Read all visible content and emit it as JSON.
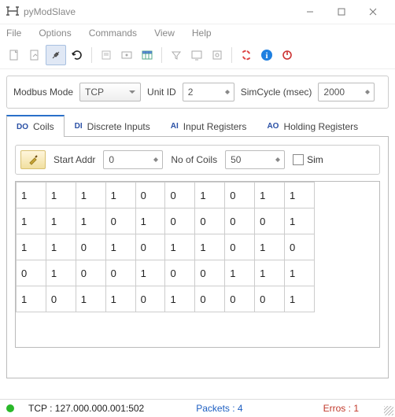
{
  "window": {
    "title": "pyModSlave"
  },
  "menu": {
    "file": "File",
    "options": "Options",
    "commands": "Commands",
    "view": "View",
    "help": "Help"
  },
  "config": {
    "mode_label": "Modbus Mode",
    "mode_value": "TCP",
    "unitid_label": "Unit ID",
    "unitid_value": "2",
    "simcycle_label": "SimCycle (msec)",
    "simcycle_value": "2000"
  },
  "tabs": {
    "coils": {
      "pre": "DO",
      "label": "Coils"
    },
    "di": {
      "pre": "DI",
      "label": "Discrete Inputs"
    },
    "ir": {
      "pre": "AI",
      "label": "Input Registers"
    },
    "hr": {
      "pre": "AO",
      "label": "Holding Registers"
    }
  },
  "coilctrl": {
    "startaddr_label": "Start Addr",
    "startaddr_value": "0",
    "nocoils_label": "No of Coils",
    "nocoils_value": "50",
    "sim_label": "Sim"
  },
  "grid": [
    [
      "1",
      "1",
      "1",
      "1",
      "0",
      "0",
      "1",
      "0",
      "1",
      "1"
    ],
    [
      "1",
      "1",
      "1",
      "0",
      "1",
      "0",
      "0",
      "0",
      "0",
      "1"
    ],
    [
      "1",
      "1",
      "0",
      "1",
      "0",
      "1",
      "1",
      "0",
      "1",
      "0"
    ],
    [
      "0",
      "1",
      "0",
      "0",
      "1",
      "0",
      "0",
      "1",
      "1",
      "1"
    ],
    [
      "1",
      "0",
      "1",
      "1",
      "0",
      "1",
      "0",
      "0",
      "0",
      "1"
    ]
  ],
  "status": {
    "conn": "TCP : 127.000.000.001:502",
    "packets": "Packets : 4",
    "errors": "Erros : 1"
  }
}
